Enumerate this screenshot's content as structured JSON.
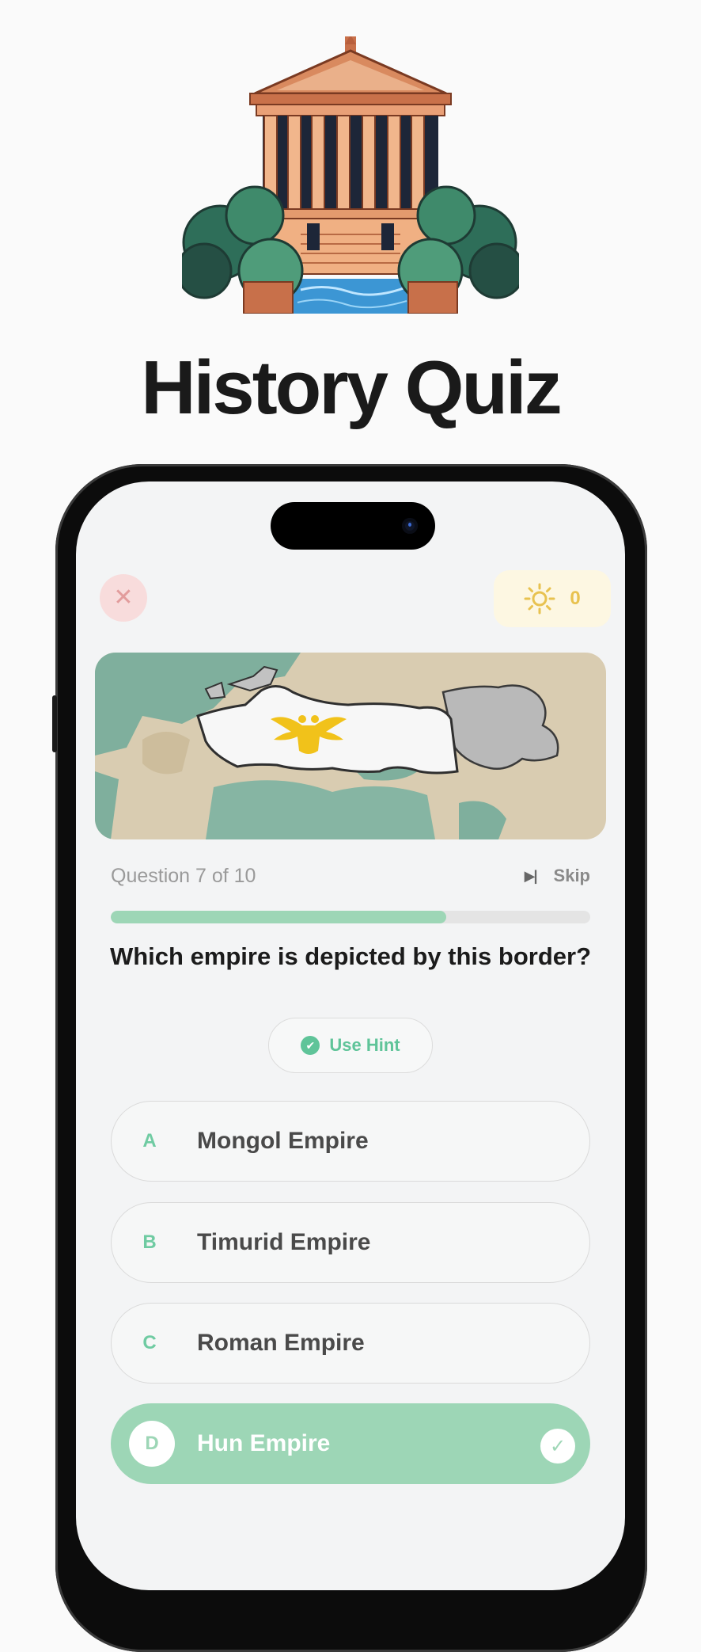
{
  "app_title": "History Quiz",
  "header": {
    "close_symbol": "✕",
    "score": "0",
    "score_icon": "sun-icon"
  },
  "map": {
    "icon": "double-headed-eagle-emblem"
  },
  "progress": {
    "label": "Question 7 of 10",
    "current": 7,
    "total": 10,
    "fraction": 0.7,
    "skip_label": "Skip",
    "skip_icon": "skip-next-icon"
  },
  "question": "Which empire is depicted by this border?",
  "hint": {
    "label": "Use Hint",
    "icon": "verified-check-icon"
  },
  "answers": [
    {
      "letter": "A",
      "text": "Mongol Empire",
      "selected": false
    },
    {
      "letter": "B",
      "text": "Timurid Empire",
      "selected": false
    },
    {
      "letter": "C",
      "text": "Roman Empire",
      "selected": false
    },
    {
      "letter": "D",
      "text": "Hun Empire",
      "selected": true
    }
  ],
  "colors": {
    "accent_green": "#9dd6b6",
    "hint_green": "#5fc499",
    "score_yellow": "#e8c24f",
    "close_red_bg": "#f8dcdc"
  }
}
